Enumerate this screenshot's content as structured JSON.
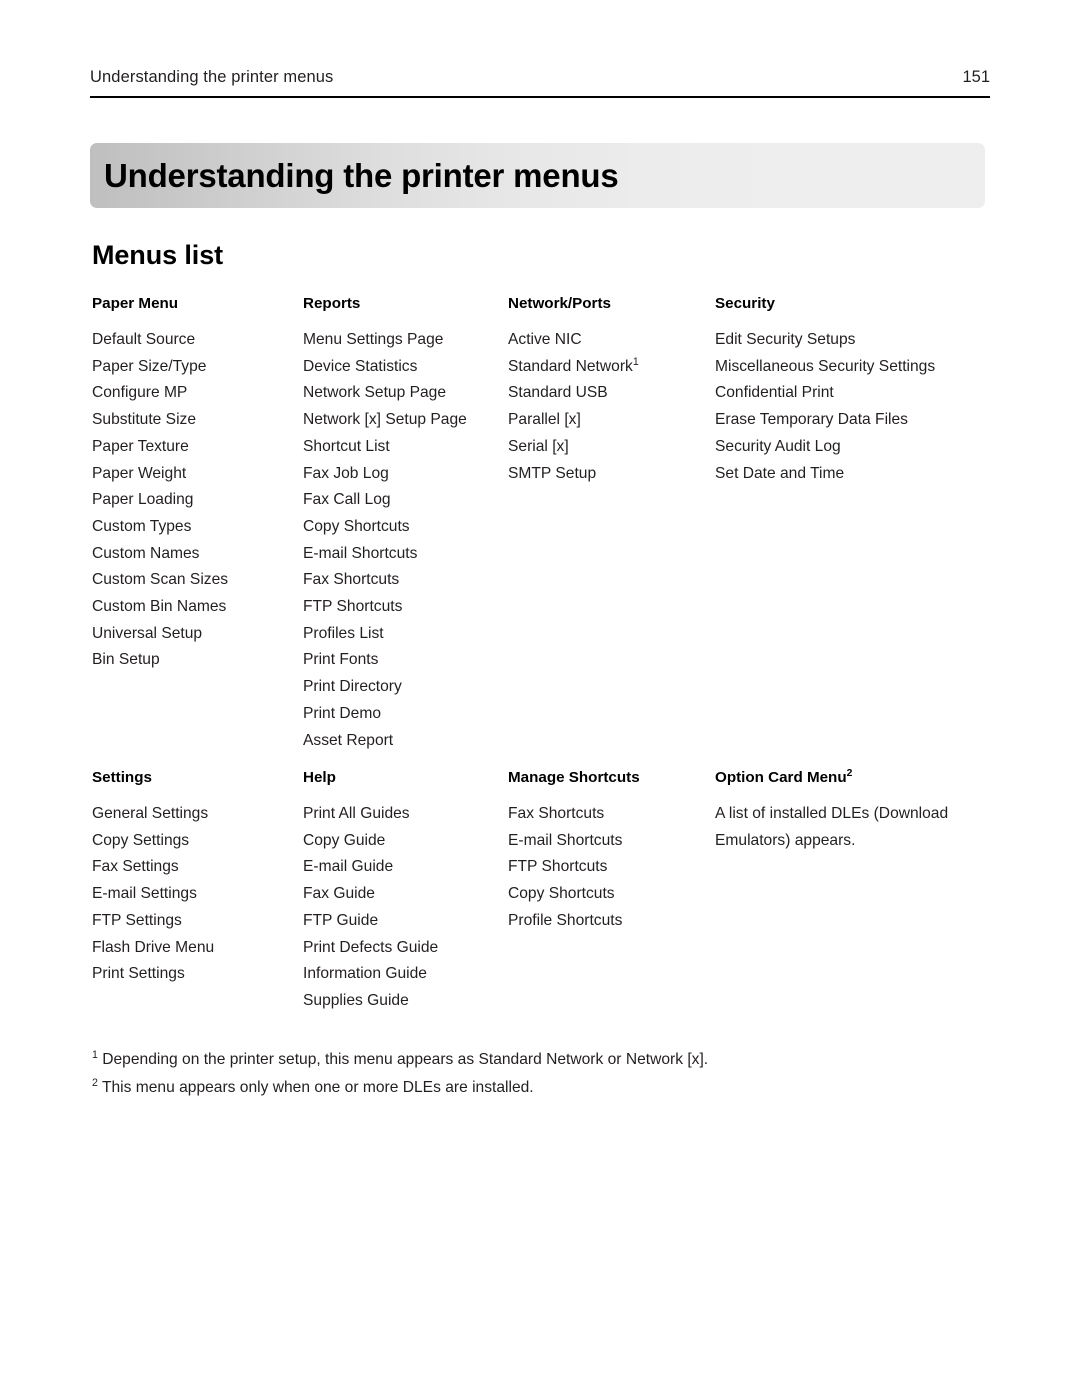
{
  "header": {
    "title": "Understanding the printer menus",
    "page_number": "151"
  },
  "chapter": {
    "title": "Understanding the printer menus"
  },
  "section": {
    "heading": "Menus list"
  },
  "menu_columns": [
    {
      "heading": "Paper Menu",
      "heading_sup": "",
      "items": [
        "Default Source",
        "Paper Size/Type",
        "Configure MP",
        "Substitute Size",
        "Paper Texture",
        "Paper Weight",
        "Paper Loading",
        "Custom Types",
        "Custom Names",
        "Custom Scan Sizes",
        "Custom Bin Names",
        "Universal Setup",
        "Bin Setup"
      ]
    },
    {
      "heading": "Reports",
      "heading_sup": "",
      "items": [
        "Menu Settings Page",
        "Device Statistics",
        "Network Setup Page",
        "Network [x] Setup Page",
        "Shortcut List",
        "Fax Job Log",
        "Fax Call Log",
        "Copy Shortcuts",
        "E-mail Shortcuts",
        "Fax Shortcuts",
        "FTP Shortcuts",
        "Profiles List",
        "Print Fonts",
        "Print Directory",
        "Print Demo",
        "Asset Report"
      ]
    },
    {
      "heading": "Network/Ports",
      "heading_sup": "",
      "items": [
        "Active NIC",
        "Standard Network",
        "Standard USB",
        "Parallel [x]",
        "Serial [x]",
        "SMTP Setup"
      ],
      "item_sups": {
        "1": "1"
      }
    },
    {
      "heading": "Security",
      "heading_sup": "",
      "items": [
        "Edit Security Setups",
        "Miscellaneous Security Settings",
        "Confidential Print",
        "Erase Temporary Data Files",
        "Security Audit Log",
        "Set Date and Time"
      ]
    },
    {
      "heading": "Settings",
      "heading_sup": "",
      "items": [
        "General Settings",
        "Copy Settings",
        "Fax Settings",
        "E-mail Settings",
        "FTP Settings",
        "Flash Drive Menu",
        "Print Settings"
      ]
    },
    {
      "heading": "Help",
      "heading_sup": "",
      "items": [
        "Print All Guides",
        "Copy Guide",
        "E-mail Guide",
        "Fax Guide",
        "FTP Guide",
        "Print Defects Guide",
        "Information Guide",
        "Supplies Guide"
      ]
    },
    {
      "heading": "Manage Shortcuts",
      "heading_sup": "",
      "items": [
        "Fax Shortcuts",
        "E-mail Shortcuts",
        "FTP Shortcuts",
        "Copy Shortcuts",
        "Profile Shortcuts"
      ]
    },
    {
      "heading": "Option Card Menu",
      "heading_sup": "2",
      "note": "A list of installed DLEs (Download Emulators) appears.",
      "items": []
    }
  ],
  "footnotes": [
    {
      "marker": "1",
      "text": "Depending on the printer setup, this menu appears as Standard Network or Network [x]."
    },
    {
      "marker": "2",
      "text": "This menu appears only when one or more DLEs are installed."
    }
  ]
}
